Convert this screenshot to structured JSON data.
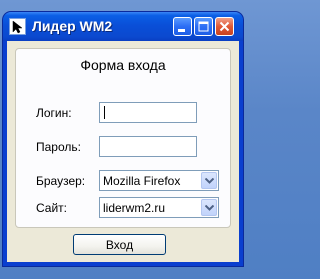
{
  "window": {
    "title": "Лидер WM2",
    "icon": "cursor-arrow-icon",
    "controls": [
      "minimize-icon",
      "maximize-icon",
      "close-icon"
    ]
  },
  "form": {
    "title": "Форма входа",
    "login_label": "Логин:",
    "login_value": "",
    "password_label": "Пароль:",
    "password_value": "",
    "browser_label": "Браузер:",
    "browser_value": "Mozilla Firefox",
    "site_label": "Сайт:",
    "site_value": "liderwm2.ru",
    "submit_label": "Вход"
  },
  "colors": {
    "titlebar": "#0a4fd8",
    "client_bg": "#ece9d8",
    "desktop": "#5a86c8"
  }
}
